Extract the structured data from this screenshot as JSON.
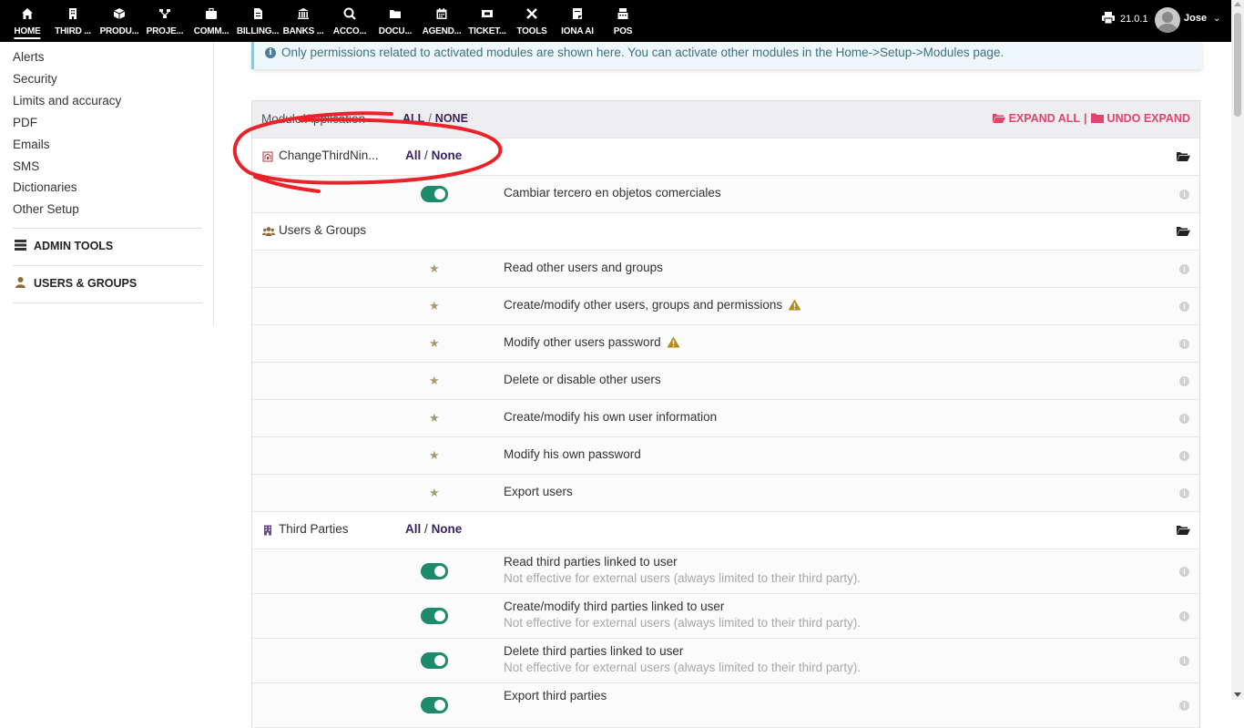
{
  "topbar": {
    "menu": [
      {
        "label": "HOME",
        "icon": "home-icon"
      },
      {
        "label": "THIRD ...",
        "icon": "building-icon"
      },
      {
        "label": "PRODU...",
        "icon": "cube-icon"
      },
      {
        "label": "PROJE...",
        "icon": "project-icon"
      },
      {
        "label": "COMM...",
        "icon": "suitcase-icon"
      },
      {
        "label": "BILLING...",
        "icon": "invoice-icon"
      },
      {
        "label": "BANKS ...",
        "icon": "bank-icon"
      },
      {
        "label": "ACCO...",
        "icon": "search-dollar-icon"
      },
      {
        "label": "DOCU...",
        "icon": "folder-icon"
      },
      {
        "label": "AGEND...",
        "icon": "calendar-icon"
      },
      {
        "label": "TICKET...",
        "icon": "ticket-icon"
      },
      {
        "label": "TOOLS",
        "icon": "tools-icon"
      },
      {
        "label": "IONA AI",
        "icon": "note-icon"
      },
      {
        "label": "POS",
        "icon": "cash-register-icon"
      }
    ],
    "version": "21.0.1",
    "user": "Jose"
  },
  "sidebar": {
    "links": [
      "Alerts",
      "Security",
      "Limits and accuracy",
      "PDF",
      "Emails",
      "SMS",
      "Dictionaries",
      "Other Setup"
    ],
    "admin_tools": "ADMIN TOOLS",
    "users_groups": "USERS & GROUPS"
  },
  "notice": "Only permissions related to activated modules are shown here. You can activate other modules in the Home->Setup->Modules page.",
  "table": {
    "header": {
      "label": "Module/Application",
      "all": "ALL",
      "sep": "/",
      "none": "NONE",
      "expand_all": "EXPAND ALL",
      "bar": "|",
      "undo_expand": "UNDO EXPAND"
    },
    "modules": {
      "changethird": {
        "title": "ChangeThirdNin...",
        "all": "All",
        "sep": "/",
        "none": "None"
      },
      "users": {
        "title": "Users & Groups"
      },
      "thirdparties": {
        "title": "Third Parties",
        "all": "All",
        "sep": "/",
        "none": "None"
      }
    },
    "perms": {
      "p1": "Cambiar tercero en objetos comerciales",
      "p2": "Read other users and groups",
      "p3": "Create/modify other users, groups and permissions",
      "p4": "Modify other users password",
      "p5": "Delete or disable other users",
      "p6": "Create/modify his own user information",
      "p7": "Modify his own password",
      "p8": "Export users",
      "p9": "Read third parties linked to user",
      "p10": "Create/modify third parties linked to user",
      "p11": "Delete third parties linked to user",
      "p12": "Export third parties",
      "sub": "Not effective for external users (always limited to their third party)."
    }
  },
  "colors": {
    "topbar": "#000000",
    "link": "#3c1f5f",
    "expand": "#e2446e",
    "toggle_on": "#1d8a6a",
    "annotation": "#e8232a"
  }
}
